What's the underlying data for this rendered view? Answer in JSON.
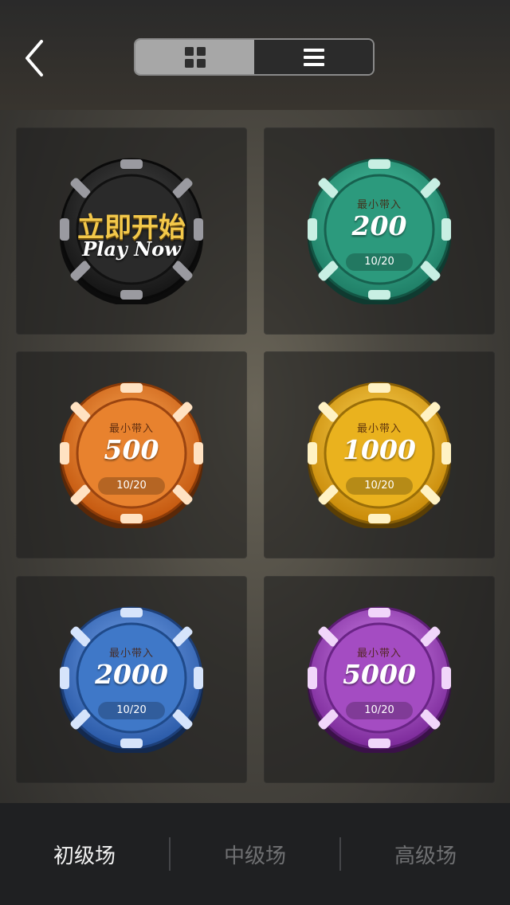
{
  "header": {
    "back_icon": "chevron-left-icon",
    "view_toggle": [
      {
        "icon": "grid-icon",
        "active": true
      },
      {
        "icon": "list-icon",
        "active": false
      }
    ]
  },
  "play_now": {
    "title_cn": "立即开始",
    "title_en": "Play Now"
  },
  "rooms": [
    {
      "min_label": "最小带入",
      "amount": "200",
      "count": "10/20",
      "color": "#2a9a7e"
    },
    {
      "min_label": "最小带入",
      "amount": "500",
      "count": "10/20",
      "color": "#e0741c"
    },
    {
      "min_label": "最小带入",
      "amount": "1000",
      "count": "10/20",
      "color": "#e8b21a"
    },
    {
      "min_label": "最小带入",
      "amount": "2000",
      "count": "10/20",
      "color": "#3d78c8"
    },
    {
      "min_label": "最小带入",
      "amount": "5000",
      "count": "10/20",
      "color": "#a54bc0"
    }
  ],
  "bottom_tabs": [
    {
      "label": "初级场",
      "active": true
    },
    {
      "label": "中级场",
      "active": false
    },
    {
      "label": "高级场",
      "active": false
    }
  ]
}
